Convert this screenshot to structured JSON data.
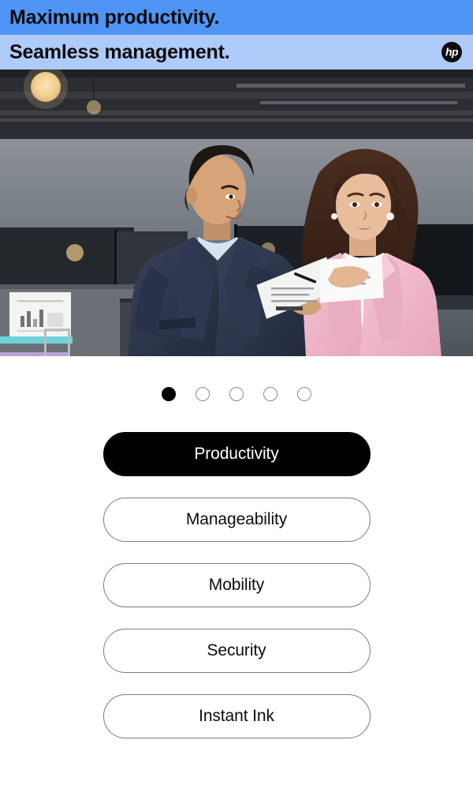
{
  "banner": {
    "line1": "Maximum productivity.",
    "line2": "Seamless management.",
    "logo_text": "hp",
    "band1_color": "#4f94f5",
    "band2_color": "#aecbfa"
  },
  "hero": {
    "alt": "Two business colleagues in an open-plan office reviewing printed documents",
    "scene": {
      "man_suit_color": "#2c3648",
      "woman_blazer_color": "#f0b9c8",
      "wall_color": "#5a6068",
      "ceiling_color": "#2b2d30",
      "pendant_light_color": "#f2d29a"
    }
  },
  "carousel": {
    "count": 5,
    "active_index": 0,
    "active_color": "#000000",
    "inactive_border_color": "#8b8b8b"
  },
  "tabs": {
    "active_index": 0,
    "items": [
      {
        "label": "Productivity"
      },
      {
        "label": "Manageability"
      },
      {
        "label": "Mobility"
      },
      {
        "label": "Security"
      },
      {
        "label": "Instant Ink"
      }
    ]
  }
}
